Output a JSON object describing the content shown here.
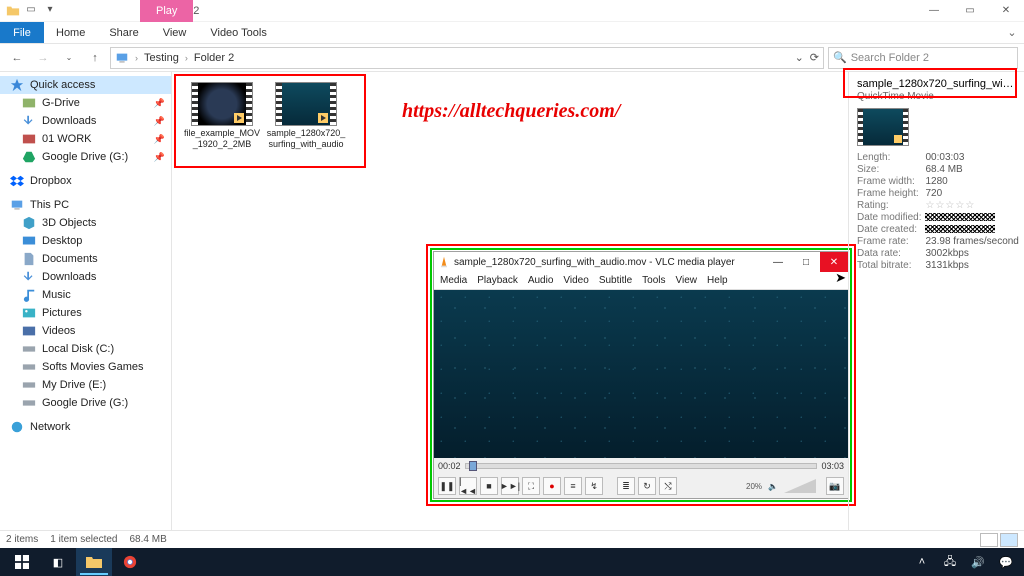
{
  "window": {
    "folder_label": "Folder 2",
    "context_tab": "Play",
    "context_group": "Video Tools"
  },
  "ribbon": {
    "file": "File",
    "tabs": [
      "Home",
      "Share",
      "View",
      "Video Tools"
    ]
  },
  "address": {
    "crumbs": [
      "Testing",
      "Folder 2"
    ],
    "search_placeholder": "Search Folder 2"
  },
  "sidebar": {
    "quick_access": "Quick access",
    "items1": [
      "G-Drive",
      "Downloads",
      "01 WORK",
      "Google Drive (G:)"
    ],
    "dropbox": "Dropbox",
    "thispc": "This PC",
    "pc_items": [
      "3D Objects",
      "Desktop",
      "Documents",
      "Downloads",
      "Music",
      "Pictures",
      "Videos",
      "Local Disk (C:)",
      "Softs Movies Games",
      "My Drive (E:)",
      "Google Drive (G:)"
    ],
    "network": "Network"
  },
  "files": [
    {
      "name": "file_example_MOV_1920_2_2MB"
    },
    {
      "name": "sample_1280x720_surfing_with_audio"
    }
  ],
  "watermark": "https://alltechqueries.com/",
  "preview": {
    "title": "sample_1280x720_surfing_with...",
    "type": "QuickTime Movie",
    "props": {
      "Length": "00:03:03",
      "Size": "68.4 MB",
      "Frame width": "1280",
      "Frame height": "720",
      "Rating": "☆☆☆☆☆",
      "Date modified": "",
      "Date created": "",
      "Frame rate": "23.98 frames/second",
      "Data rate": "3002kbps",
      "Total bitrate": "3131kbps"
    }
  },
  "vlc": {
    "title": "sample_1280x720_surfing_with_audio.mov - VLC media player",
    "menus": [
      "Media",
      "Playback",
      "Audio",
      "Video",
      "Subtitle",
      "Tools",
      "View",
      "Help"
    ],
    "elapsed": "00:02",
    "total": "03:03",
    "volume_pct": "20%"
  },
  "status": {
    "items": "2 items",
    "selected": "1 item selected",
    "size": "68.4 MB"
  }
}
